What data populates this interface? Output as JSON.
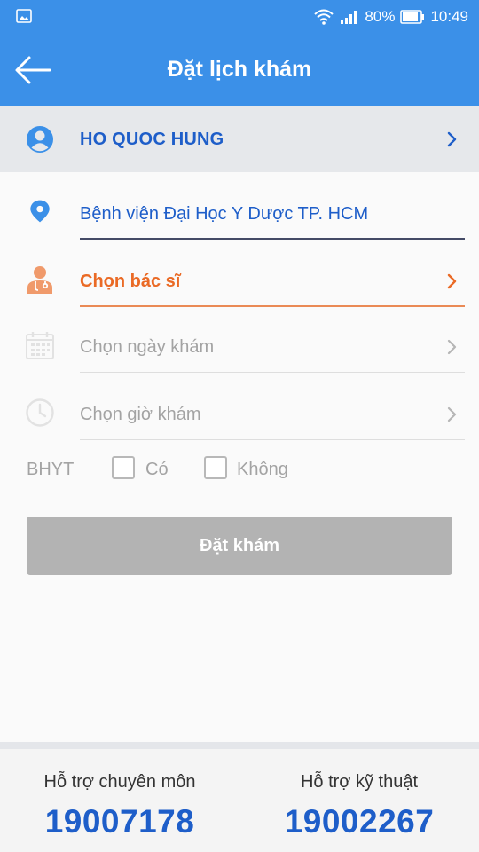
{
  "status_bar": {
    "battery": "80%",
    "time": "10:49"
  },
  "app_bar": {
    "title": "Đặt lịch khám"
  },
  "patient": {
    "name": "HO QUOC HUNG"
  },
  "form": {
    "hospital": "Bệnh viện Đại Học Y Dược TP. HCM",
    "doctor": "Chọn bác sĩ",
    "date": "Chọn ngày khám",
    "time": "Chọn giờ khám",
    "bhyt": {
      "label": "BHYT",
      "yes": "Có",
      "no": "Không"
    },
    "submit": "Đặt khám"
  },
  "footer": {
    "professional": {
      "label": "Hỗ trợ chuyên môn",
      "phone": "19007178"
    },
    "technical": {
      "label": "Hỗ trợ kỹ thuật",
      "phone": "19002267"
    }
  },
  "colors": {
    "primary": "#3b90e8",
    "link_blue": "#1e5ec9",
    "accent_orange": "#ea6a25",
    "disabled": "#b3b3b3"
  },
  "icons": [
    "image-icon",
    "wifi-icon",
    "signal-icon",
    "battery-icon",
    "back-arrow-icon",
    "user-circle-icon",
    "chevron-right-icon",
    "location-pin-icon",
    "doctor-icon",
    "calendar-icon",
    "clock-icon"
  ]
}
